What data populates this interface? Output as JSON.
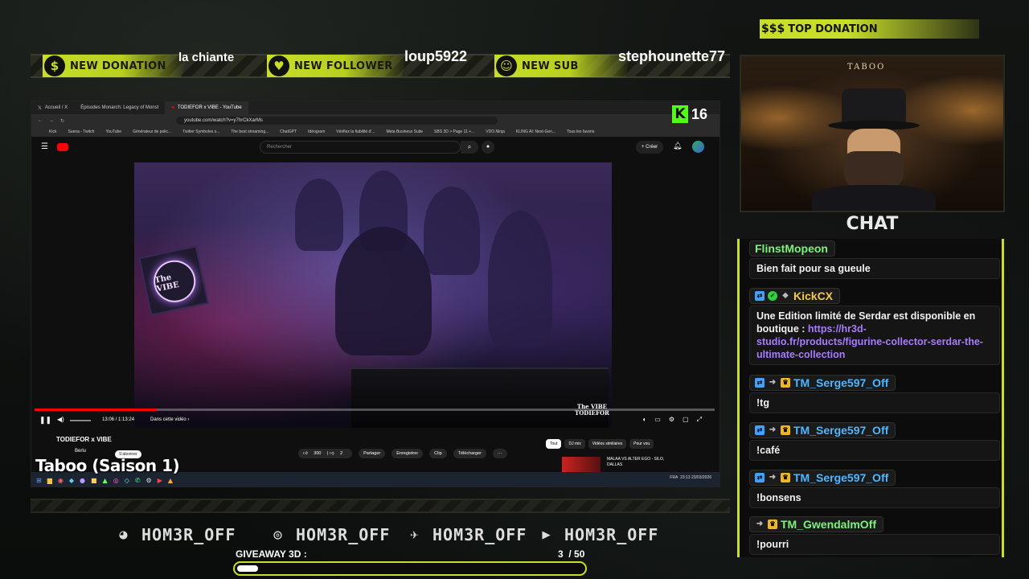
{
  "alerts": {
    "donation": {
      "label": "NEW DONATION",
      "name": "la chiante"
    },
    "follower": {
      "label": "NEW FOLLOWER",
      "name": "loup5922"
    },
    "sub": {
      "label": "NEW SUB",
      "name": "stephounette77"
    }
  },
  "top_donation": {
    "label": "TOP DONATION",
    "icon_text": "$$$"
  },
  "kick": {
    "letter": "K",
    "viewers": "16"
  },
  "browser": {
    "tabs": [
      "Accueil / X",
      "Épisodes Monarch: Legacy of Monst",
      "TODIEFOR x VIBE - YouTube"
    ],
    "url": "youtube.com/watch?v=y7hrCkXarMs",
    "bookmarks": [
      "Kick",
      "Suena - Twitch",
      "YouTube",
      "Générateur de polic...",
      "Twitter Symboles s...",
      "The best streaming...",
      "ChatGPT",
      "Idéogram",
      "Vérifiez la fiabilité d'...",
      "Meta Business Suite",
      "SBS 3D > Page 11 +...",
      "VDO.Ninja",
      "KLING AI: Next-Gen...",
      "Tous les favoris"
    ],
    "search_placeholder": "Rechercher",
    "create_label": "+ Créer",
    "video": {
      "logo_text": "The VIBE",
      "time": "13:06 / 1:13:24",
      "chapter": "Dans cette vidéo  ›",
      "watermark_line1": "The VIBE",
      "watermark_line2": "TODIEFOR",
      "progress": 0.18
    },
    "title": "TODIEFOR x VIBE",
    "channel": "Berlu",
    "subscribe": "S'abonner",
    "actions": {
      "likes": "300",
      "dislikes": "2",
      "share": "Partager",
      "save": "Enregistrer",
      "clip": "Clip",
      "download": "Télécharger",
      "more": "···"
    },
    "chips": [
      "Tout",
      "DJ mix",
      "Vidéos similaires",
      "Pour vou"
    ],
    "rec_title_1": "MALAA VS ALTER EGO - SILO,",
    "rec_title_2": "DALLAS",
    "tray": {
      "lang": "FRA",
      "time": "23:13",
      "date": "23/03/2026"
    }
  },
  "season_title": "Taboo (Saison 1)",
  "cam": {
    "sign": "TABOO"
  },
  "chat": {
    "title": "CHAT",
    "messages": [
      {
        "user": "FlinstMopeon",
        "text": "Bien fait pour sa gueule",
        "color": "#7df27d"
      },
      {
        "user": "KickCX",
        "text_before": "Une Edition limité de Serdar est disponible en boutique : ",
        "link": "https://hr3d-studio.fr/products/figurine-collector-serdar-the-ultimate-collection",
        "color": "#f3c74a"
      },
      {
        "user": "TM_Serge597_Off",
        "text": "!tg",
        "color": "#4fb6ff"
      },
      {
        "user": "TM_Serge597_Off",
        "text": "!café",
        "color": "#4fb6ff"
      },
      {
        "user": "TM_Serge597_Off",
        "text": "!bonsens",
        "color": "#4fb6ff"
      },
      {
        "user": "TM_GwendalmOff",
        "text": "!pourri",
        "color": "#7df27d"
      }
    ]
  },
  "socials": [
    {
      "icon": "discord-icon",
      "handle": "HOM3R_OFF"
    },
    {
      "icon": "instagram-icon",
      "handle": "HOM3R_OFF"
    },
    {
      "icon": "twitter-icon",
      "handle": "HOM3R_OFF"
    },
    {
      "icon": "youtube-icon",
      "handle": "HOM3R_OFF"
    }
  ],
  "giveaway": {
    "label": "GIVEAWAY 3D :",
    "current": "3",
    "goal": "/ 50",
    "progress": 0.06
  },
  "colors": {
    "accent": "#c8de2a",
    "kick_green": "#53fc18",
    "link": "#a97bff"
  }
}
